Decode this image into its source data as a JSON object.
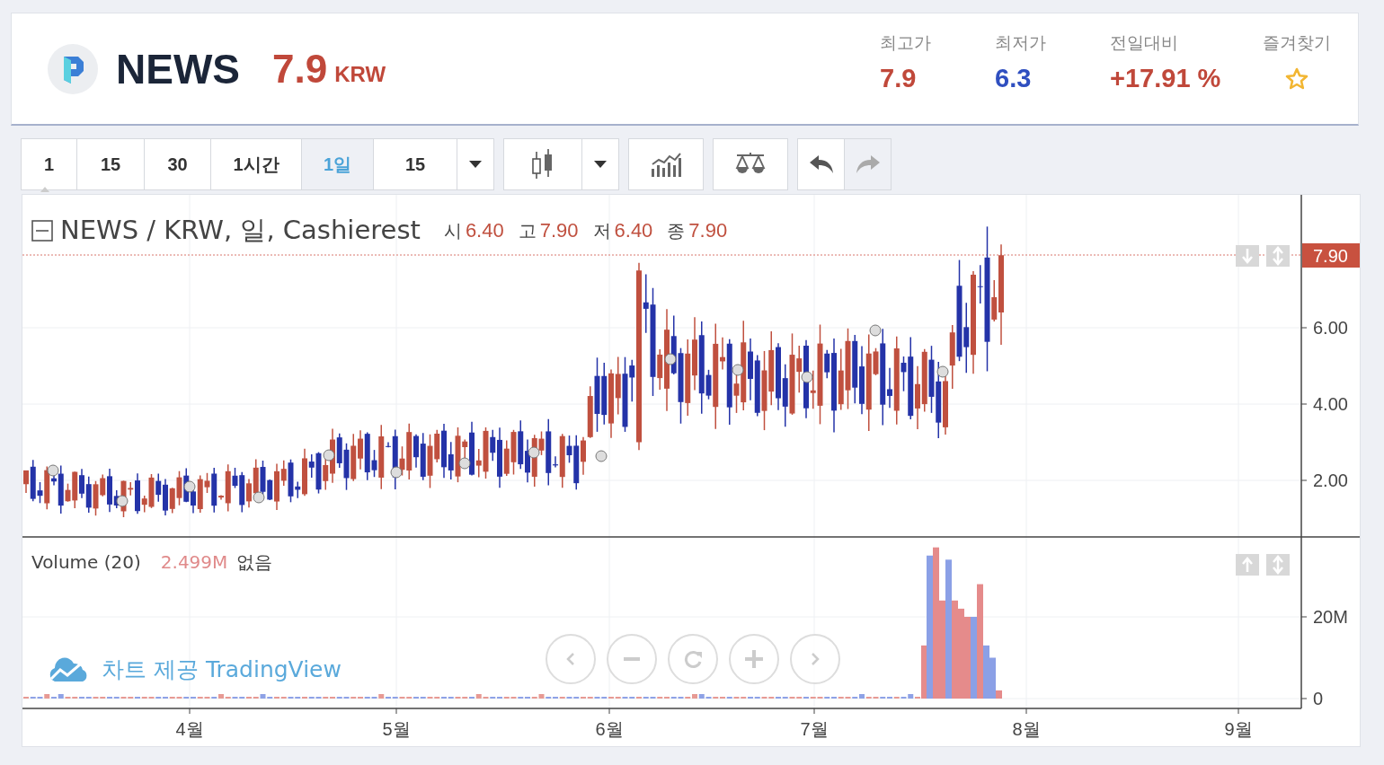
{
  "header": {
    "symbol": "NEWS",
    "price": "7.9",
    "currency": "KRW",
    "stats": [
      {
        "label": "최고가",
        "value": "7.9",
        "color": "#c0483a"
      },
      {
        "label": "최저가",
        "value": "6.3",
        "color": "#2f4fc0"
      },
      {
        "label": "전일대비",
        "value": "+17.91 %",
        "color": "#c0483a"
      }
    ],
    "favorite": {
      "label": "즐겨찾기",
      "on": false
    }
  },
  "toolbar": {
    "intervals": [
      {
        "label": "1",
        "selected": false
      },
      {
        "label": "15",
        "selected": false
      },
      {
        "label": "30",
        "selected": false
      },
      {
        "label": "1시간",
        "selected": false
      },
      {
        "label": "1일",
        "selected": true
      },
      {
        "label": "15",
        "selected": false
      }
    ],
    "undo": {
      "disabled": false
    },
    "redo": {
      "disabled": true
    }
  },
  "chart": {
    "legend": {
      "title": "NEWS / KRW, 일, Cashierest",
      "ohlc": [
        {
          "label": "시",
          "value": "6.40"
        },
        {
          "label": "고",
          "value": "7.90"
        },
        {
          "label": "저",
          "value": "6.40"
        },
        {
          "label": "종",
          "value": "7.90"
        }
      ]
    },
    "last_price": "7.90",
    "price_ticks": [
      "6.00",
      "4.00",
      "2.00"
    ],
    "volume_legend": {
      "title": "Volume (20)",
      "value": "2.499M",
      "note": "없음"
    },
    "volume_ticks": [
      "20M",
      "0"
    ],
    "months": [
      "4월",
      "5월",
      "6월",
      "7월",
      "8월",
      "9월"
    ],
    "attribution": "차트 제공 TradingView"
  }
}
